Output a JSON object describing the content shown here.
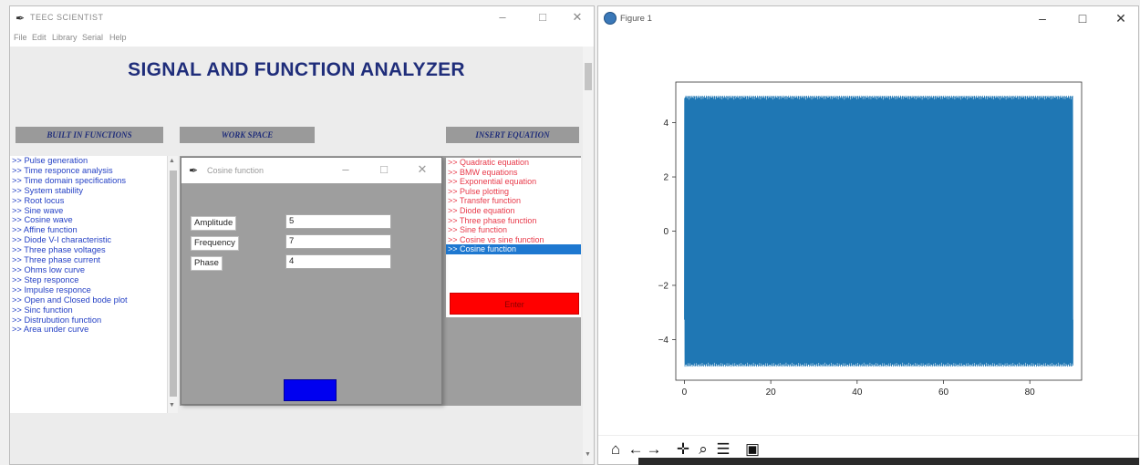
{
  "app": {
    "title": "TEEC SCIENTIST",
    "menu": [
      "File",
      "Edit",
      "Library",
      "Serial",
      "Help"
    ],
    "main_title": "SIGNAL AND FUNCTION ANALYZER",
    "sections": {
      "builtin": "BUILT IN FUNCTIONS",
      "workspace": "WORK SPACE",
      "insert": "INSERT EQUATION"
    },
    "builtin_items": [
      ">> Pulse generation",
      ">> Time responce analysis",
      ">> Time domain specifications",
      ">> System stability",
      ">> Root locus",
      ">> Sine wave",
      ">> Cosine wave",
      ">> Affine function",
      ">> Diode V-I characteristic",
      ">> Three phase voltages",
      ">> Three phase current",
      ">> Ohms low curve",
      ">> Step responce",
      ">> Impulse responce",
      ">> Open and Closed bode plot",
      ">> Sinc function",
      ">> Distrubution function",
      ">> Area under curve"
    ],
    "insert_items": [
      ">> Quadratic equation",
      ">> BMW equations",
      ">> Exponential equation",
      ">> Pulse plotting",
      ">> Transfer function",
      ">> Diode equation",
      ">> Three phase function",
      ">> Sine function",
      ">> Cosine vs sine function",
      ">> Cosine function"
    ],
    "insert_selected": ">> Cosine function",
    "insert_enter_label": "Enter"
  },
  "dialog": {
    "title": "Cosine function",
    "fields": [
      {
        "label": "Amplitude",
        "value": "5"
      },
      {
        "label": "Frequency",
        "value": "7"
      },
      {
        "label": "Phase",
        "value": "4"
      }
    ]
  },
  "figure": {
    "title": "Figure 1",
    "colors": {
      "line": "#1f77b4"
    },
    "toolbar_icons": [
      "home-icon",
      "back-arrow-icon",
      "forward-arrow-icon",
      "pan-icon",
      "zoom-icon",
      "configure-subplots-icon",
      "save-icon"
    ]
  },
  "chart_data": {
    "type": "line",
    "title": "",
    "xlabel": "",
    "ylabel": "",
    "xlim": [
      -2,
      92
    ],
    "ylim": [
      -5.5,
      5.5
    ],
    "x_ticks": [
      0,
      20,
      40,
      60,
      80
    ],
    "y_ticks": [
      -4,
      -2,
      0,
      2,
      4
    ],
    "x_tick_labels": [
      "0",
      "20",
      "40",
      "60",
      "80"
    ],
    "y_tick_labels": [
      "−4",
      "−2",
      "0",
      "2",
      "4"
    ],
    "grid": false,
    "series": [
      {
        "function": "cosine",
        "amplitude": 5,
        "frequency": 7,
        "phase": 4,
        "x_range": [
          0,
          90
        ]
      }
    ]
  }
}
